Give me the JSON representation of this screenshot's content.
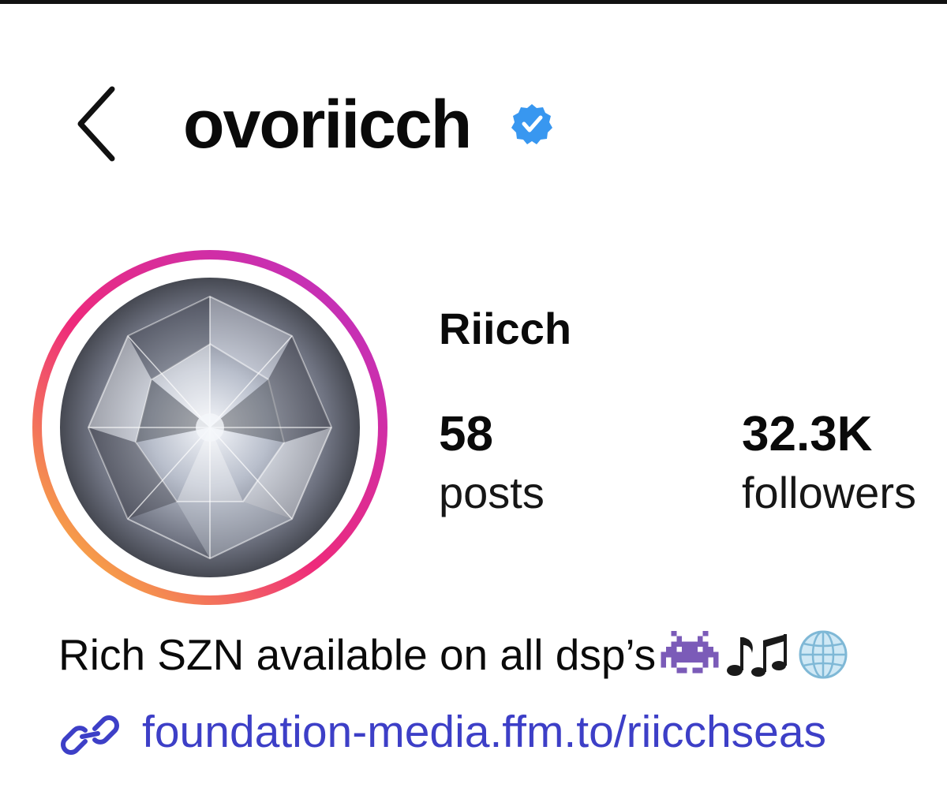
{
  "header": {
    "username": "ovoriicch",
    "verified": true,
    "accent_color": "#3897f0"
  },
  "profile": {
    "display_name": "Riicch",
    "avatar_subject": "diamond",
    "story_ring_colors": [
      "#f9ce34",
      "#ee2a7b",
      "#b832c9"
    ]
  },
  "stats": {
    "posts": {
      "value": "58",
      "label": "posts"
    },
    "followers": {
      "value": "32.3K",
      "label": "followers"
    }
  },
  "bio": {
    "text": "Rich SZN available on all dsp’s",
    "emojis": [
      "alien-monster-emoji",
      "musical-notes-emoji",
      "globe-emoji"
    ]
  },
  "link": {
    "text": "foundation-media.ffm.to/riicchseas",
    "color": "#3d3fc7"
  }
}
